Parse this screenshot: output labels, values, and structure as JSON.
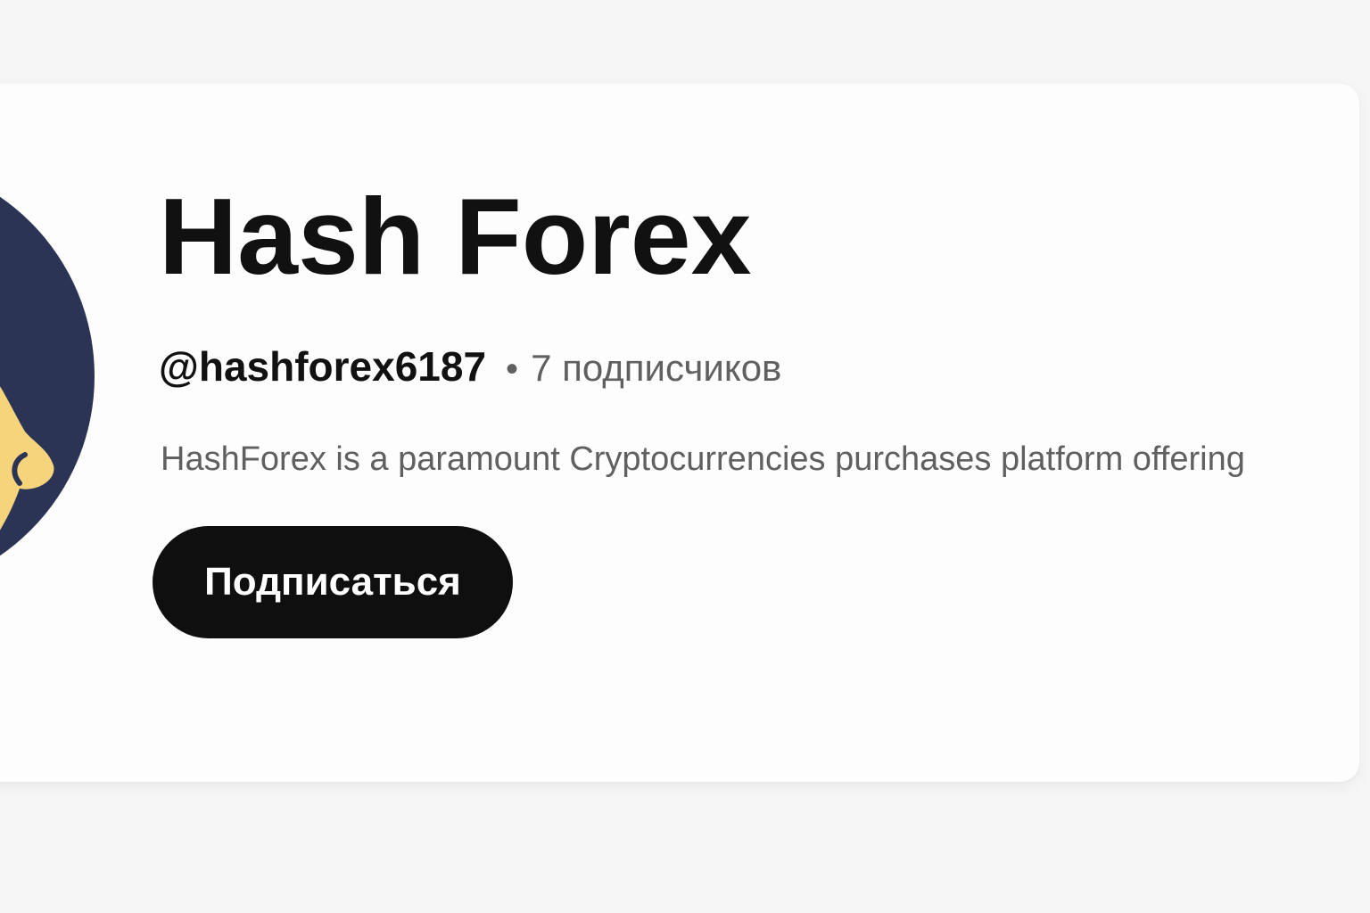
{
  "channel": {
    "name": "Hash Forex",
    "handle": "@hashforex6187",
    "separator": "•",
    "subscribers": "7 подписчиков",
    "description": "HashForex is a paramount Cryptocurrencies purchases platform offering"
  },
  "actions": {
    "subscribe_label": "Подписаться"
  },
  "colors": {
    "page_background": "#f6f6f6",
    "card_background": "#fdfdfd",
    "button_background": "#0f0f0f",
    "avatar_background": "#2b3454",
    "avatar_accent": "#f6d47b"
  }
}
